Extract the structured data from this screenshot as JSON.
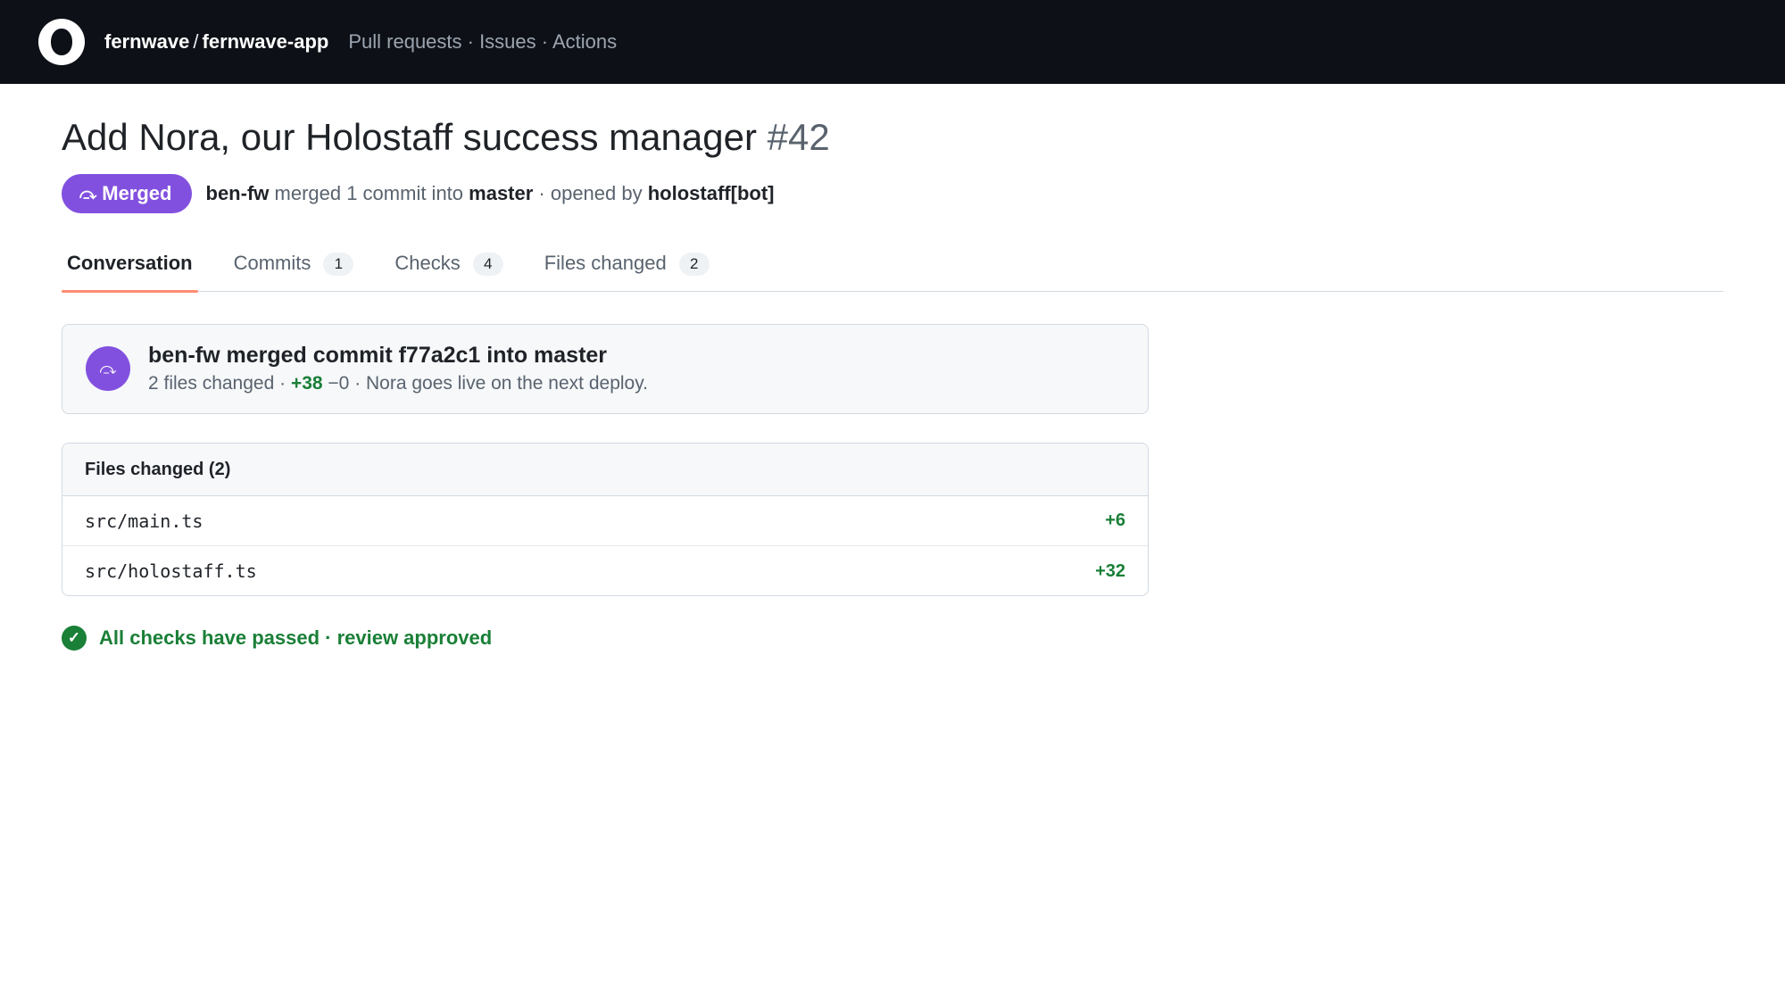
{
  "topbar": {
    "logo_icon": "app-logo-icon",
    "owner": "fernwave",
    "separator": "/",
    "repo": "fernwave-app",
    "nav": "Pull requests · Issues · Actions"
  },
  "pr": {
    "title": "Add Nora, our Holostaff success manager",
    "number": "#42",
    "status_label": "Merged",
    "status_icon": "merge-icon",
    "status_color": "#8250df",
    "meta": {
      "merger": "ben-fw",
      "merged_text": " merged 1 commit into ",
      "branch": "master",
      "opened_text": " · opened by ",
      "author": "holostaff[bot]"
    }
  },
  "tabs": [
    {
      "label": "Conversation",
      "count": null,
      "active": true
    },
    {
      "label": "Commits",
      "count": "1",
      "active": false
    },
    {
      "label": "Checks",
      "count": "4",
      "active": false
    },
    {
      "label": "Files changed",
      "count": "2",
      "active": false
    }
  ],
  "merge_event": {
    "icon": "merge-icon",
    "title": "ben-fw merged commit f77a2c1 into master",
    "files_text": "2 files changed · ",
    "additions": "+38",
    "deletions": " −0 ",
    "message": "· Nora goes live on the next deploy."
  },
  "files": {
    "header": "Files changed (2)",
    "items": [
      {
        "path": "src/main.ts",
        "additions": "+6"
      },
      {
        "path": "src/holostaff.ts",
        "additions": "+32"
      }
    ]
  },
  "checks": {
    "icon": "check-circle-icon",
    "text": "All checks have passed · review approved",
    "color": "#1a7f37"
  }
}
